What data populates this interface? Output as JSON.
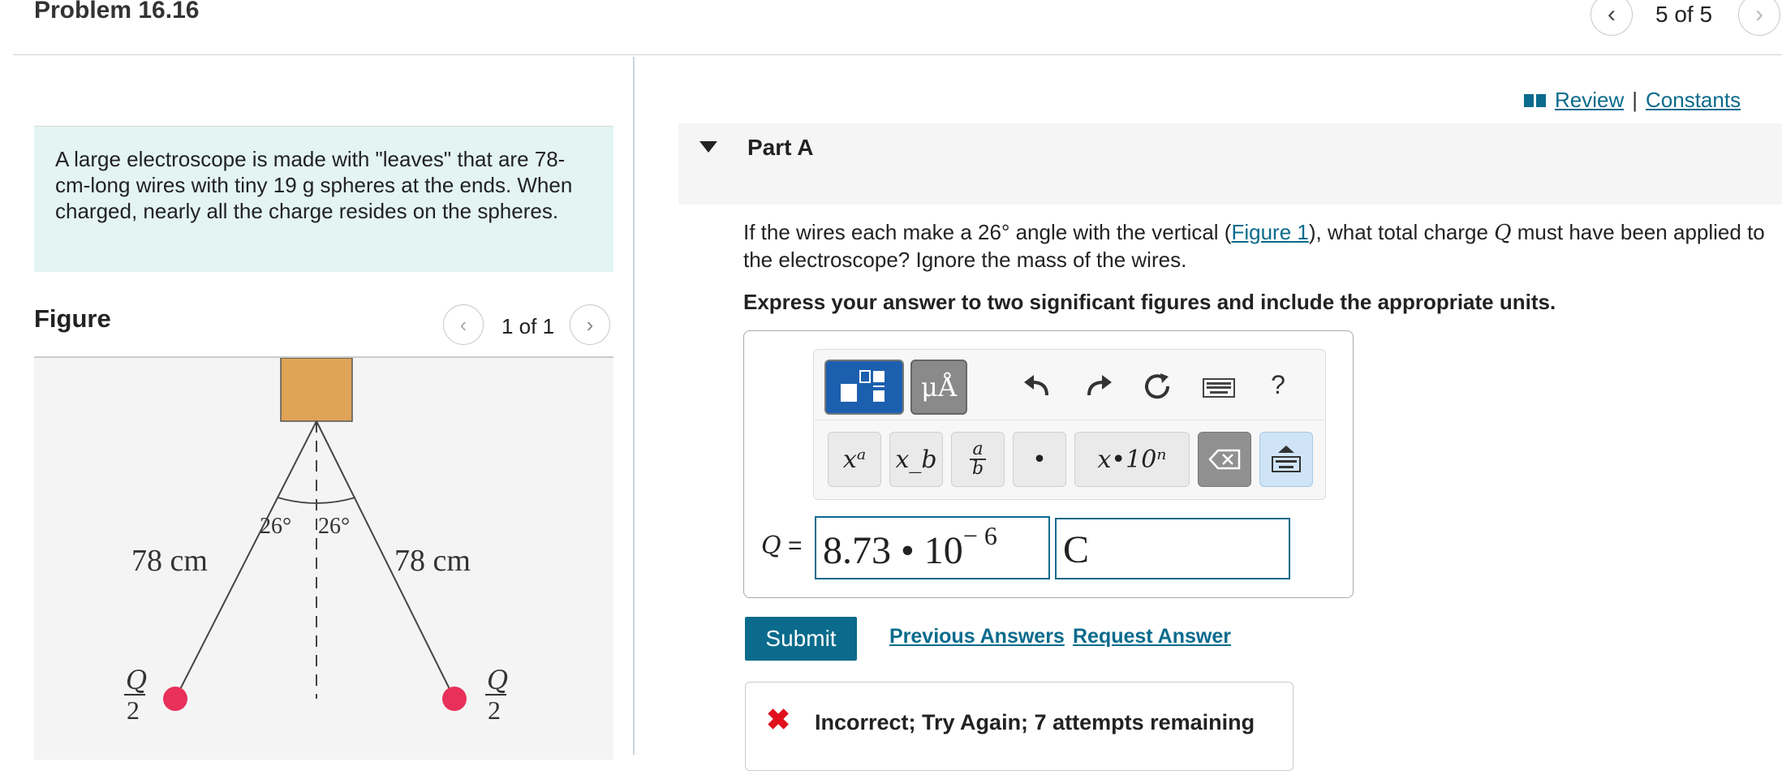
{
  "problem": {
    "title": "Problem 16.16"
  },
  "pager": {
    "count_text": "5 of 5"
  },
  "description": {
    "text": "A large electroscope is made with \"leaves\" that are 78-cm-long wires with tiny 19  g spheres at the ends. When charged, nearly all the charge resides on the spheres."
  },
  "figure": {
    "title": "Figure",
    "count_text": "1 of 1",
    "left_length": "78 cm",
    "right_length": "78 cm",
    "angle_left": "26°",
    "angle_right": "26°",
    "charge_numerator": "Q",
    "charge_denominator": "2",
    "colors": {
      "box": "#e0a457",
      "sphere": "#e8305a",
      "background": "#f4f4f4"
    }
  },
  "links": {
    "review": "Review",
    "separator": "|",
    "constants": "Constants"
  },
  "part": {
    "title": "Part A"
  },
  "question": {
    "text_before": "If the wires each make a 26° angle with the vertical (",
    "figure_link": "Figure 1",
    "text_middle": "), what total charge ",
    "symbol": "Q",
    "text_after": " must have been applied to the electroscope? Ignore the mass of the wires.",
    "instruction": "Express your answer to two significant figures and include the appropriate units."
  },
  "toolbar": {
    "units_label": "μÅ",
    "help_label": "?",
    "sup_label": "xᵃ",
    "sub_label": "x_b",
    "frac_top": "a",
    "frac_bottom": "b",
    "dot_label": "•",
    "sci_label": "x•10ⁿ",
    "icons": [
      "templates-icon",
      "units-icon",
      "undo-icon",
      "redo-icon",
      "reset-icon",
      "keyboard-icon",
      "help-icon",
      "backspace-icon",
      "keyboard-toggle-icon"
    ]
  },
  "answer": {
    "label": "Q",
    "equals": "=",
    "value_mantissa": "8.73 • 10",
    "value_exponent": "− 6",
    "unit": "C"
  },
  "actions": {
    "submit": "Submit",
    "previous_answers": "Previous Answers",
    "request_answer": "Request Answer"
  },
  "feedback": {
    "icon": "✖",
    "text": "Incorrect; Try Again; 7 attempts remaining"
  },
  "colors": {
    "link": "#0a6b8c",
    "accent": "#0a6b8c",
    "error": "#e0101d",
    "description_bg": "#e3f4f3"
  }
}
